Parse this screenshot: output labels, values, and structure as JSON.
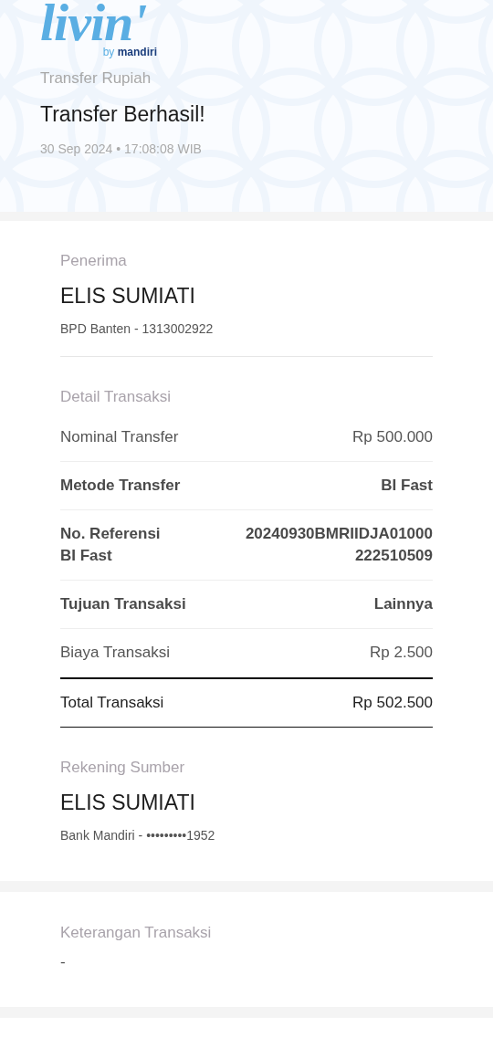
{
  "header": {
    "logo": {
      "wordmark": "livin'",
      "tagline": "by **mandiri**"
    },
    "category": "Transfer Rupiah",
    "title": "Transfer Berhasil!",
    "datetime": "30 Sep 2024 • 17:08:08 WIB"
  },
  "recipient": {
    "label": "Penerima",
    "name": "ELIS SUMIATI",
    "account": "BPD Banten - 1313002922"
  },
  "details": {
    "label": "Detail Transaksi",
    "rows": [
      {
        "kind": "detail",
        "bold": false,
        "label": "Nominal Transfer",
        "value": "Rp 500.000"
      },
      {
        "kind": "detail",
        "bold": true,
        "label": "Metode Transfer",
        "value": "BI Fast"
      },
      {
        "kind": "detail",
        "bold": true,
        "label": "No. Referensi BI Fast",
        "value": "20240930BMRIIDJA01000222510509"
      },
      {
        "kind": "detail",
        "bold": true,
        "label": "Tujuan Transaksi",
        "value": "Lainnya"
      },
      {
        "kind": "detail",
        "bold": false,
        "label": "Biaya Transaksi",
        "value": "Rp 2.500"
      },
      {
        "kind": "total",
        "bold": false,
        "label": "Total Transaksi",
        "value": "Rp 502.500"
      }
    ]
  },
  "source": {
    "label": "Rekening Sumber",
    "name": "ELIS SUMIATI",
    "account": "Bank Mandiri - •••••••••1952"
  },
  "note": {
    "label": "Keterangan Transaksi",
    "value": "-"
  }
}
